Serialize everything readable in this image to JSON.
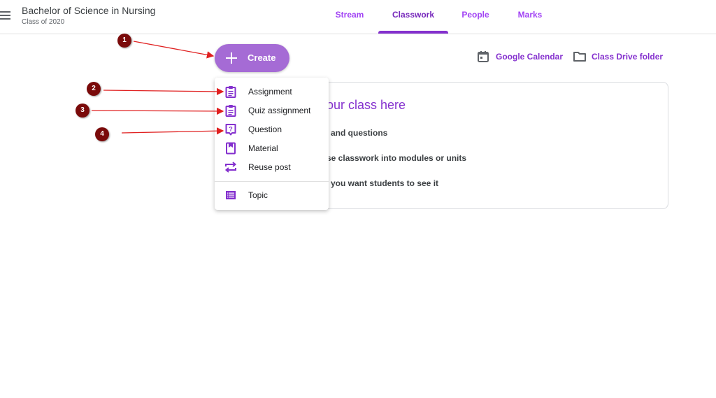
{
  "header": {
    "menu_icon": "hamburger-menu-icon",
    "class_title": "Bachelor of Science in Nursing",
    "class_subtitle": "Class of 2020",
    "tabs": [
      {
        "label": "Stream",
        "active": false
      },
      {
        "label": "Classwork",
        "active": true
      },
      {
        "label": "People",
        "active": false
      },
      {
        "label": "Marks",
        "active": false
      }
    ]
  },
  "toolbar": {
    "create_label": "Create",
    "create_icon": "plus-icon",
    "calendar_label": "Google Calendar",
    "calendar_icon": "calendar-icon",
    "drive_label": "Class Drive folder",
    "drive_icon": "folder-icon"
  },
  "create_menu": {
    "items": [
      {
        "label": "Assignment",
        "icon": "assignment-icon"
      },
      {
        "label": "Quiz assignment",
        "icon": "quiz-assignment-icon"
      },
      {
        "label": "Question",
        "icon": "question-icon"
      },
      {
        "label": "Material",
        "icon": "material-icon"
      },
      {
        "label": "Reuse post",
        "icon": "reuse-icon"
      },
      {
        "label": "Topic",
        "icon": "topic-icon"
      }
    ]
  },
  "empty_card": {
    "title": "our class here",
    "lines": [
      "and questions",
      "se classwork into modules or units",
      "you want students to see it"
    ]
  },
  "annotations": {
    "badges": [
      "1",
      "2",
      "3",
      "4"
    ],
    "color": "#7a0a0a",
    "arrow_color": "#e02020"
  },
  "colors": {
    "accent": "#8430ce",
    "create_button": "#a56bd5",
    "tab_inactive": "#a142f4"
  }
}
